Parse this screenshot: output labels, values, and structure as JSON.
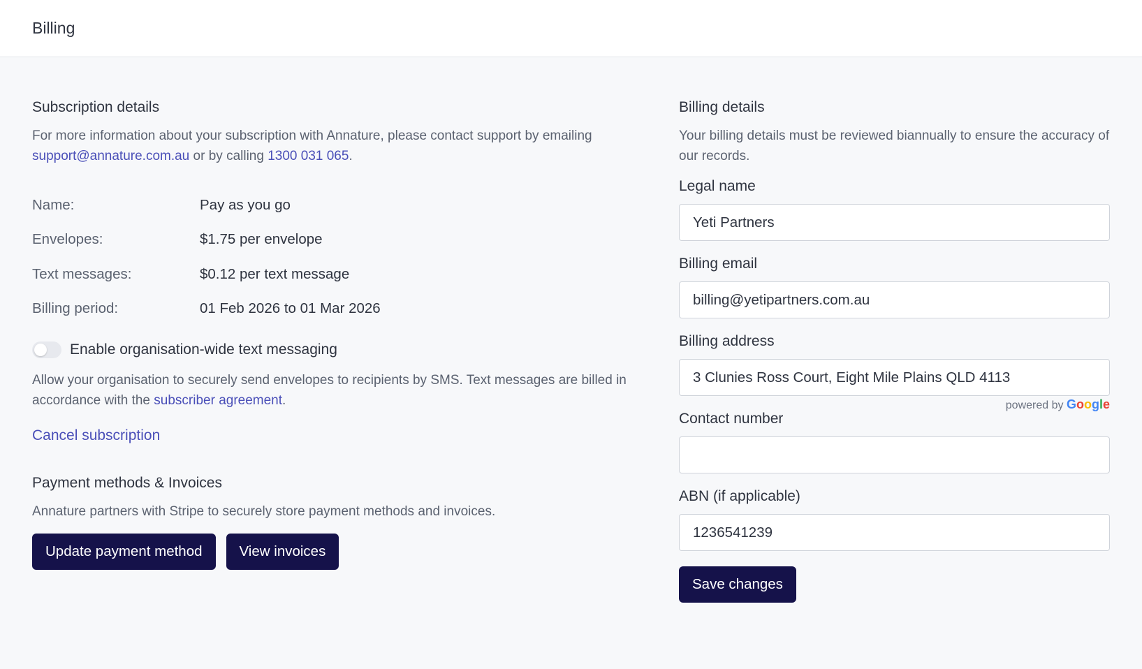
{
  "header": {
    "title": "Billing"
  },
  "subscription": {
    "heading": "Subscription details",
    "intro_prefix": "For more information about your subscription with Annature, please contact support by emailing ",
    "email_link": "support@annature.com.au",
    "intro_middle": " or by calling ",
    "phone_link": "1300 031 065",
    "intro_suffix": ".",
    "rows": [
      {
        "label": "Name:",
        "value": "Pay as you go"
      },
      {
        "label": "Envelopes:",
        "value": "$1.75 per envelope"
      },
      {
        "label": "Text messages:",
        "value": "$0.12 per text message"
      },
      {
        "label": "Billing period:",
        "value": "01 Feb 2026 to 01 Mar 2026"
      }
    ],
    "sms_toggle": {
      "label": "Enable organisation-wide text messaging",
      "enabled": false
    },
    "sms_desc_prefix": "Allow your organisation to securely send envelopes to recipients by SMS. Text messages are billed in accordance with the ",
    "sms_desc_link": "subscriber agreement",
    "sms_desc_suffix": ".",
    "cancel_label": "Cancel subscription"
  },
  "payments": {
    "heading": "Payment methods & Invoices",
    "desc": "Annature partners with Stripe to securely store payment methods and invoices.",
    "update_button": "Update payment method",
    "invoices_button": "View invoices"
  },
  "billing": {
    "heading": "Billing details",
    "desc": "Your billing details must be reviewed biannually to ensure the accuracy of our records.",
    "legal_name_label": "Legal name",
    "legal_name_value": "Yeti Partners",
    "email_label": "Billing email",
    "email_value": "billing@yetipartners.com.au",
    "address_label": "Billing address",
    "address_value": "3 Clunies Ross Court, Eight Mile Plains QLD 4113",
    "powered_by": "powered by",
    "google": "Google",
    "contact_label": "Contact number",
    "contact_value": "",
    "abn_label": "ABN (if applicable)",
    "abn_value": "1236541239",
    "save_button": "Save changes"
  },
  "colors": {
    "primary_button": "#15124a",
    "link": "#4a4fb8",
    "background": "#f7f8fa"
  }
}
